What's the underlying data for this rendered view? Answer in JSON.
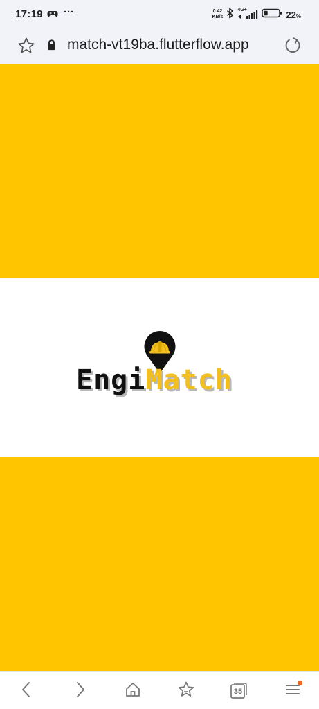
{
  "status_bar": {
    "time": "17:19",
    "more_indicator": "···",
    "net_speed_value": "0.42",
    "net_speed_unit": "KB/s",
    "network_type": "4G+",
    "battery_percent": "22",
    "battery_unit": "%"
  },
  "address_bar": {
    "url": "match-vt19ba.flutterflow.app",
    "icons": [
      "bookmark-star-icon",
      "lock-icon",
      "reload-icon"
    ]
  },
  "page": {
    "logo": {
      "part_1": "Engi",
      "part_2": "Match"
    }
  },
  "bottom_nav": {
    "tab_count": "35",
    "icons": [
      "back-icon",
      "forward-icon",
      "home-icon",
      "bookmarks-icon",
      "tabs-icon",
      "menu-icon"
    ]
  },
  "colors": {
    "accent_yellow": "#ffc600",
    "logo_yellow": "#f2bf1f",
    "notification_dot": "#f26a21"
  }
}
